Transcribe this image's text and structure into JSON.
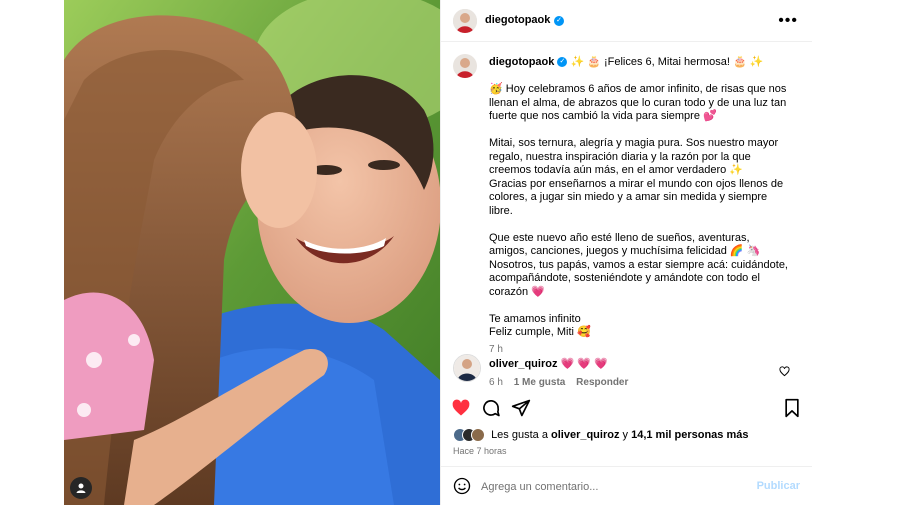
{
  "post_header": {
    "username": "diegotopaok",
    "verified_badge": "✓",
    "more_label": "•••"
  },
  "caption": {
    "username": "diegotopaok",
    "verified_badge": "✓",
    "title": "✨ 🎂 ¡Felices 6, Mitai hermosa! 🎂 ✨",
    "paragraphs": [
      "🥳 Hoy celebramos 6 años de amor infinito, de risas que nos llenan el alma, de abrazos que lo curan todo y de una luz tan fuerte que nos cambió la vida para siempre 💕",
      "Mitai, sos ternura, alegría y magia pura. Sos nuestro mayor regalo, nuestra inspiración diaria y la razón por la que creemos todavía aún más, en el amor verdadero ✨",
      "Gracias por enseñarnos a mirar el mundo con ojos llenos de colores, a jugar sin miedo y a amar sin medida y siempre libre.",
      "Que este nuevo año esté lleno de sueños, aventuras, amigos, canciones, juegos y muchísima felicidad 🌈 🦄",
      "Nosotros, tus papás, vamos a estar siempre acá: cuidándote, acompañándote, sosteniéndote y amándote con todo el corazón 💗",
      "Te amamos infinito",
      "Feliz cumple, Miti 🥰"
    ],
    "time": "7 h"
  },
  "comment": {
    "username": "oliver_quiroz",
    "text": "💗 💗 💗",
    "time": "6 h",
    "likes": "1 Me gusta",
    "reply": "Responder"
  },
  "likes": {
    "prefix": "Les gusta a",
    "user": "oliver_quiroz",
    "middle": "y",
    "count": "14,1 mil personas más"
  },
  "time_ago": "Hace 7 horas",
  "add_comment": {
    "placeholder": "Agrega un comentario...",
    "publish": "Publicar"
  },
  "icons": [
    "user-tag-icon",
    "more-icon",
    "verified-icon",
    "heart-icon",
    "comment-icon",
    "share-icon",
    "bookmark-icon",
    "emoji-icon",
    "small-heart-icon"
  ],
  "colors": {
    "verified": "#0095f6",
    "liked_heart": "#ff3040",
    "publish_disabled": "#b3dbff",
    "secondary_text": "#737373"
  }
}
